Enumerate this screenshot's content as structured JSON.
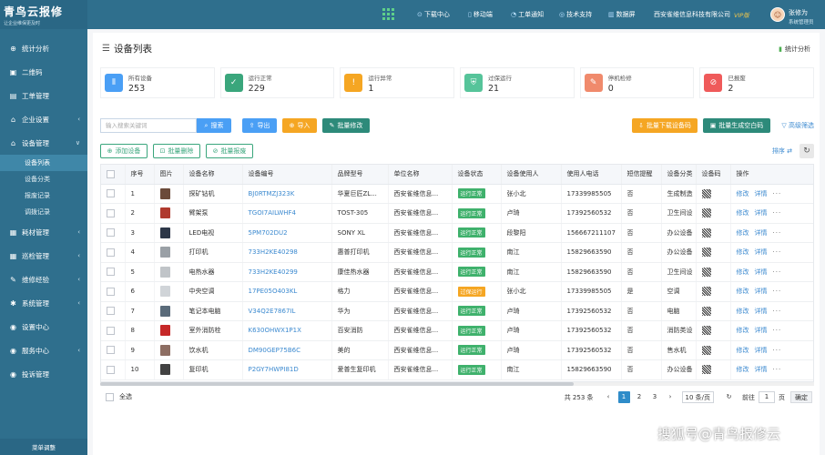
{
  "brand": {
    "logo_text": "青鸟云报修",
    "slogan": "让企业维保更及时"
  },
  "sidebar": {
    "items": [
      {
        "icon": "globe-icon",
        "glyph": "⊕",
        "label": "统计分析",
        "chev": ""
      },
      {
        "icon": "qrcode-icon",
        "glyph": "▣",
        "label": "二维码",
        "chev": ""
      },
      {
        "icon": "ticket-icon",
        "glyph": "▤",
        "label": "工单管理",
        "chev": ""
      },
      {
        "icon": "home-icon",
        "glyph": "⌂",
        "label": "企业设置",
        "chev": "‹"
      },
      {
        "icon": "home-icon",
        "glyph": "⌂",
        "label": "设备管理",
        "chev": "∨"
      }
    ],
    "subitems": [
      "设备列表",
      "设备分类",
      "报废记录",
      "调拨记录"
    ],
    "items2": [
      {
        "icon": "box-icon",
        "glyph": "▦",
        "label": "耗材管理",
        "chev": "‹"
      },
      {
        "icon": "patrol-icon",
        "glyph": "▦",
        "label": "巡检管理",
        "chev": "‹"
      },
      {
        "icon": "wrench-icon",
        "glyph": "✎",
        "label": "维修经验",
        "chev": "‹"
      },
      {
        "icon": "gear-icon",
        "glyph": "✱",
        "label": "系统管理",
        "chev": "‹"
      },
      {
        "icon": "message-icon",
        "glyph": "◉",
        "label": "设置中心",
        "chev": ""
      },
      {
        "icon": "service-icon",
        "glyph": "◉",
        "label": "服务中心",
        "chev": "‹"
      },
      {
        "icon": "complaint-icon",
        "glyph": "◉",
        "label": "投诉管理",
        "chev": ""
      }
    ],
    "footer": "菜单调整"
  },
  "topbar": {
    "download": "下载中心",
    "mobile": "移动端",
    "notice": "工单通知",
    "support": "技术支持",
    "screen": "数据屏",
    "company": "西安雀维信息科技有限公司",
    "vip": "VIP版",
    "user_name": "张修为",
    "user_role": "系统管理员"
  },
  "page": {
    "title": "设备列表",
    "stat_link": "统计分析"
  },
  "stats": [
    {
      "label": "所有设备",
      "value": "253",
      "color": "#4a9ff5",
      "icon": "device-icon",
      "glyph": "⦀"
    },
    {
      "label": "运行正常",
      "value": "229",
      "color": "#3aa67c",
      "icon": "check-icon",
      "glyph": "✓"
    },
    {
      "label": "运行异常",
      "value": "1",
      "color": "#f5a623",
      "icon": "warning-icon",
      "glyph": "!"
    },
    {
      "label": "过保运行",
      "value": "21",
      "color": "#56c49a",
      "icon": "shield-icon",
      "glyph": "⛨"
    },
    {
      "label": "停机检修",
      "value": "0",
      "color": "#f08a6c",
      "icon": "wrench-icon",
      "glyph": "✎"
    },
    {
      "label": "已报废",
      "value": "2",
      "color": "#ef5a5a",
      "icon": "ban-icon",
      "glyph": "⊘"
    }
  ],
  "toolbar": {
    "search_placeholder": "输入搜索关键词",
    "search": "搜索",
    "export": "导出",
    "import": "导入",
    "batch_edit": "批量修改",
    "batch_download_qr": "批量下载设备码",
    "batch_gen_qr": "批量生成空白码",
    "advanced_filter": "高级筛选"
  },
  "actions": {
    "add": "添加设备",
    "batch_delete": "批量删除",
    "batch_scrap": "批量报废",
    "sort": "排序"
  },
  "table": {
    "headers": [
      "",
      "序号",
      "图片",
      "设备名称",
      "设备编号",
      "品牌型号",
      "单位名称",
      "设备状态",
      "设备使用人",
      "使用人电话",
      "短信提醒",
      "设备分类",
      "设备码",
      "操作"
    ],
    "rows": [
      {
        "no": "1",
        "name": "探矿钻机",
        "code": "BJ0RTMZJ323K",
        "brand": "华夏巨匠ZL...",
        "unit": "西安雀维信息...",
        "status": "运行正常",
        "user": "张小北",
        "phone": "17339985505",
        "sms": "否",
        "category": "生成制造"
      },
      {
        "no": "2",
        "name": "臂架泵",
        "code": "TGOI7AILWHF4",
        "brand": "TOST-305",
        "unit": "西安雀维信息...",
        "status": "运行正常",
        "user": "卢琦",
        "phone": "17392560532",
        "sms": "否",
        "category": "卫生间设"
      },
      {
        "no": "3",
        "name": "LED电视",
        "code": "5PM702DU2",
        "brand": "SONY XL",
        "unit": "西安雀维信息...",
        "status": "运行正常",
        "user": "段黎阳",
        "phone": "156667211107",
        "sms": "否",
        "category": "办公设备"
      },
      {
        "no": "4",
        "name": "打印机",
        "code": "733H2KE40298",
        "brand": "惠普打印机",
        "unit": "西安雀维信息...",
        "status": "运行正常",
        "user": "南江",
        "phone": "15829663590",
        "sms": "否",
        "category": "办公设备"
      },
      {
        "no": "5",
        "name": "电热水器",
        "code": "733H2KE40299",
        "brand": "康佳热水器",
        "unit": "西安雀维信息...",
        "status": "运行正常",
        "user": "南江",
        "phone": "15829663590",
        "sms": "否",
        "category": "卫生间设"
      },
      {
        "no": "6",
        "name": "中央空调",
        "code": "17PE05O403KL",
        "brand": "格力",
        "unit": "西安雀维信息...",
        "status": "过保运行",
        "user": "张小北",
        "phone": "17339985505",
        "sms": "是",
        "category": "空调"
      },
      {
        "no": "7",
        "name": "笔记本电脑",
        "code": "V34Q2E7867IL",
        "brand": "华为",
        "unit": "西安雀维信息...",
        "status": "运行正常",
        "user": "卢琦",
        "phone": "17392560532",
        "sms": "否",
        "category": "电脑"
      },
      {
        "no": "8",
        "name": "室外消防栓",
        "code": "K630OHWX1P1X",
        "brand": "百安消防",
        "unit": "西安雀维信息...",
        "status": "运行正常",
        "user": "卢琦",
        "phone": "17392560532",
        "sms": "否",
        "category": "消防类设"
      },
      {
        "no": "9",
        "name": "饮水机",
        "code": "DM90GEP75B6C",
        "brand": "美的",
        "unit": "西安雀维信息...",
        "status": "运行正常",
        "user": "卢琦",
        "phone": "17392560532",
        "sms": "否",
        "category": "售水机"
      },
      {
        "no": "10",
        "name": "复印机",
        "code": "P2GY7HWPI81D",
        "brand": "爱普生复印机",
        "unit": "西安雀维信息...",
        "status": "运行正常",
        "user": "南江",
        "phone": "15829663590",
        "sms": "否",
        "category": "办公设备"
      }
    ],
    "op_edit": "修改",
    "op_detail": "详情",
    "op_more": "···"
  },
  "footer": {
    "select_all": "全选",
    "total": "共 253 条",
    "pages": [
      "1",
      "2",
      "3"
    ],
    "page_size": "10 条/页",
    "goto": "前往",
    "goto_value": "1",
    "page_unit": "页",
    "confirm": "确定"
  },
  "watermark": "搜狐号@青鸟报修云"
}
